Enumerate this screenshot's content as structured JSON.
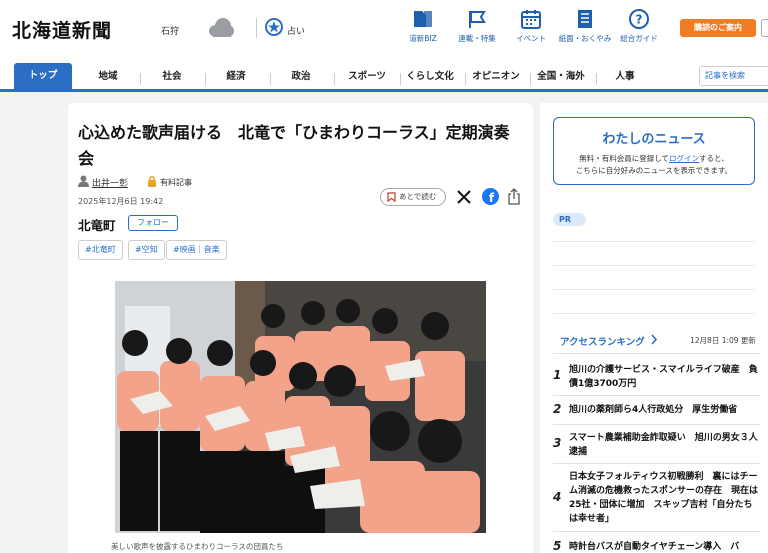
{
  "header": {
    "logo": "北海道新聞",
    "region": "石狩",
    "fortune_label": "占い",
    "nav_icons": [
      {
        "label": "道新BIZ",
        "icon": "biz-icon"
      },
      {
        "label": "連載・特集",
        "icon": "flag-icon"
      },
      {
        "label": "イベント",
        "icon": "calendar-icon"
      },
      {
        "label": "紙面・おくやみ",
        "icon": "newspaper-icon"
      },
      {
        "label": "総合ガイド",
        "icon": "help-icon"
      }
    ],
    "subscribe_label": "購読のご案内"
  },
  "categories": [
    "トップ",
    "地域",
    "社会",
    "経済",
    "政治",
    "スポーツ",
    "くらし文化",
    "オピニオン",
    "全国・海外",
    "人事"
  ],
  "search_placeholder": "記事を検索",
  "article": {
    "title": "心込めた歌声届ける　北竜で「ひまわりコーラス」定期演奏会",
    "author": "出井一彰",
    "paid_label": "有料記事",
    "date": "2025年12月6日 19:42",
    "read_later_label": "あとで読む",
    "place": "北竜町",
    "follow_label": "フォロー",
    "tags": [
      "#北竜町",
      "#空知",
      "#映画｜音楽"
    ],
    "caption": "美しい歌声を披露するひまわりコーラスの団員たち"
  },
  "sidebar": {
    "mynews_title": "わたしのニュース",
    "mynews_text_1": "無料・有料会員に登録して",
    "mynews_login": "ログイン",
    "mynews_text_2": "すると、",
    "mynews_text_3": "こちらに自分好みのニュースを表示できます。",
    "pr_label": "PR",
    "ranking_title": "アクセスランキング",
    "ranking_time": "12月8日 1:09 更新",
    "ranking": [
      {
        "num": "1",
        "text": "旭川の介護サービス・スマイルライフ破産　負債1億3700万円"
      },
      {
        "num": "2",
        "text": "旭川の薬剤師ら4人行政処分　厚生労働省"
      },
      {
        "num": "3",
        "text": "スマート農業補助金詐取疑い　旭川の男女３人逮捕"
      },
      {
        "num": "4",
        "text": "日本女子フォルティウス初戦勝利　裏にはチーム消滅の危機救ったスポンサーの存在　現在は25社・団体に増加　スキップ吉村「自分たちは幸せ者」"
      },
      {
        "num": "5",
        "text": "時計台バスが自動タイヤチェーン導入　バ"
      }
    ]
  }
}
